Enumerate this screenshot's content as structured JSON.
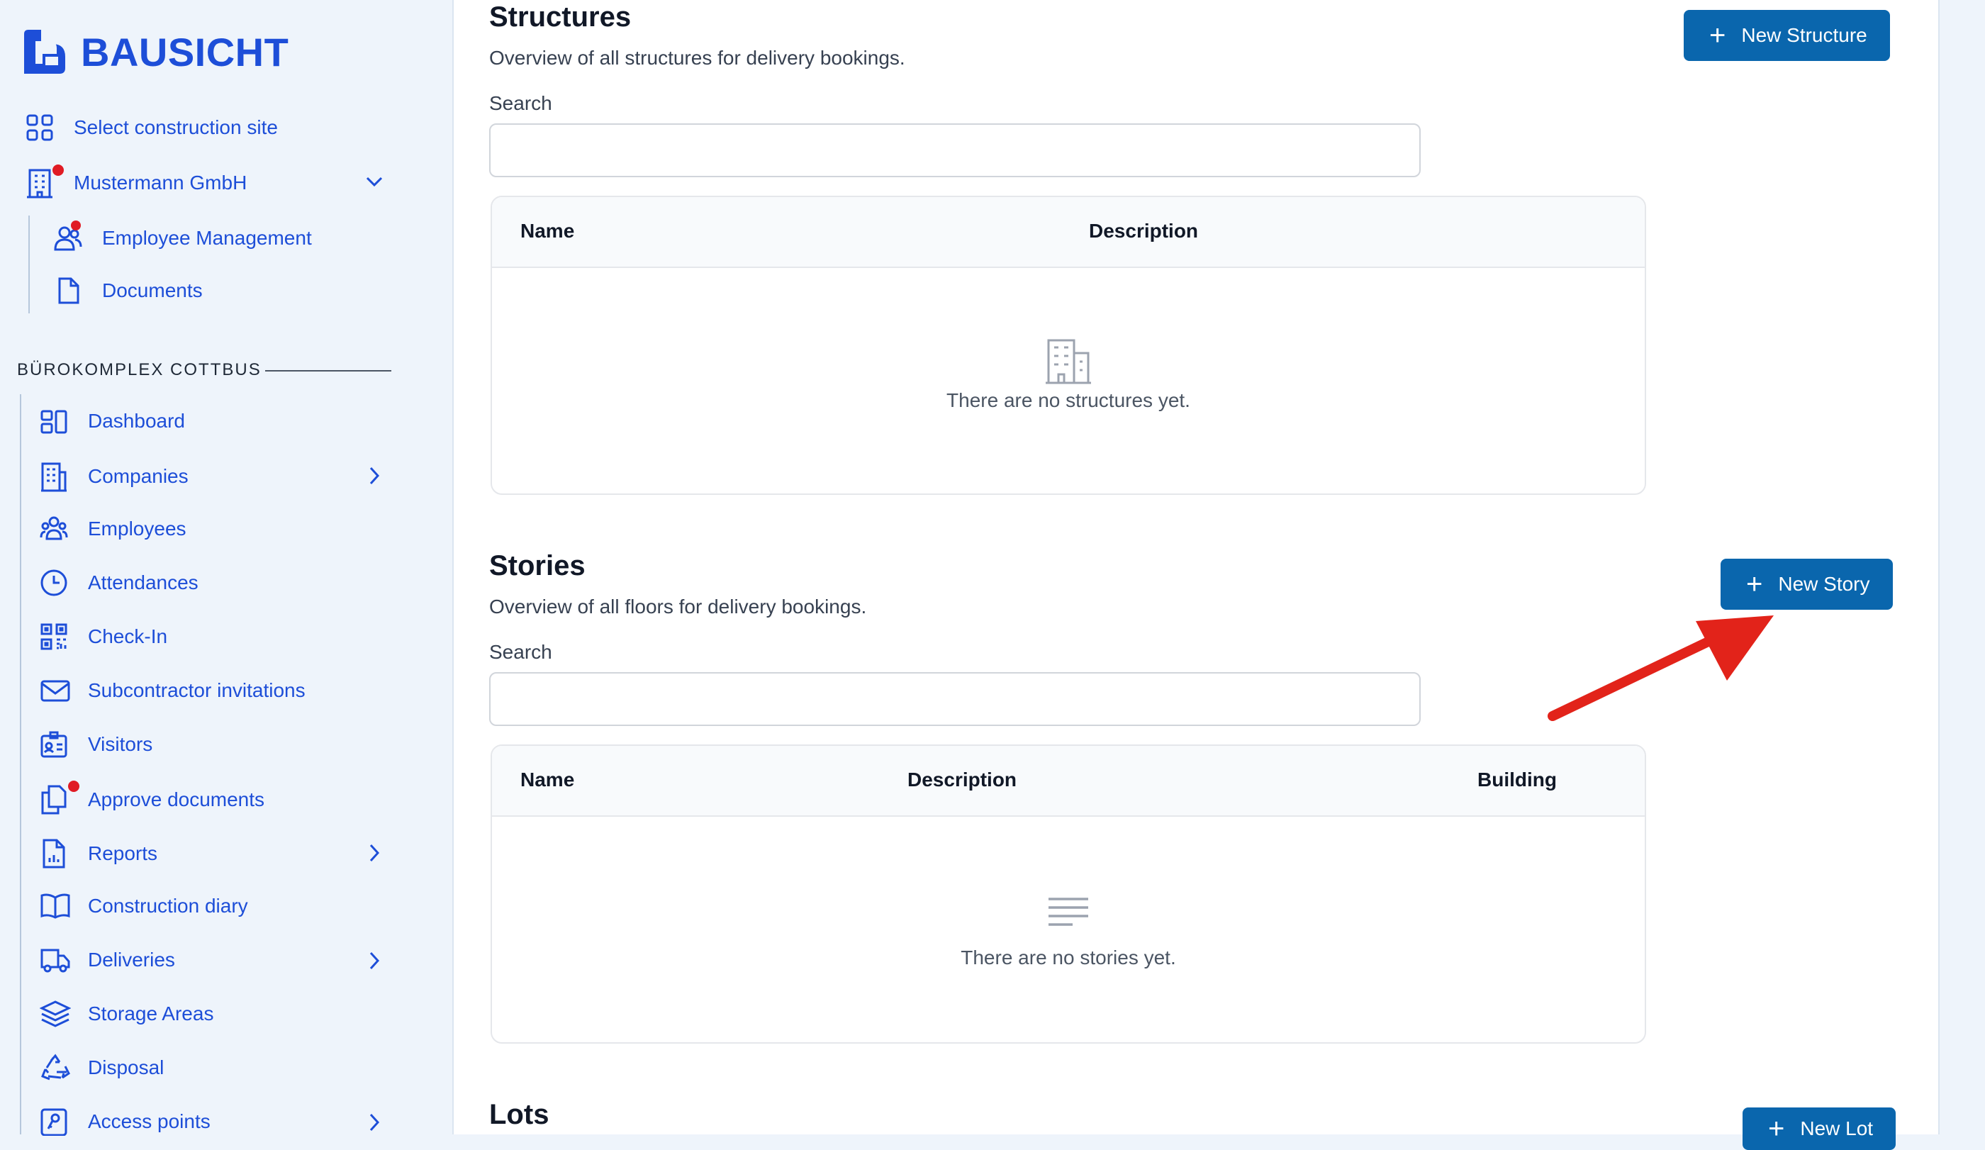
{
  "app": {
    "name": "BAUSICHT"
  },
  "sidebar": {
    "top": [
      {
        "label": "Select construction site",
        "icon": "grid-icon"
      },
      {
        "label": "Mustermann GmbH",
        "icon": "building-icon",
        "has_dot": true,
        "expanded": true
      }
    ],
    "sub": [
      {
        "label": "Employee Management",
        "icon": "users-icon",
        "has_dot": true
      },
      {
        "label": "Documents",
        "icon": "document-icon"
      }
    ],
    "section_title": "BÜROKOMPLEX COTTBUS",
    "items": [
      {
        "label": "Dashboard",
        "icon": "dashboard-icon"
      },
      {
        "label": "Companies",
        "icon": "building-icon",
        "has_children": true
      },
      {
        "label": "Employees",
        "icon": "users-group-icon"
      },
      {
        "label": "Attendances",
        "icon": "clock-icon"
      },
      {
        "label": "Check-In",
        "icon": "qr-code-icon"
      },
      {
        "label": "Subcontractor invitations",
        "icon": "envelope-icon"
      },
      {
        "label": "Visitors",
        "icon": "id-badge-icon"
      },
      {
        "label": "Approve documents",
        "icon": "documents-icon",
        "has_dot": true
      },
      {
        "label": "Reports",
        "icon": "report-icon",
        "has_children": true
      },
      {
        "label": "Construction diary",
        "icon": "book-icon"
      },
      {
        "label": "Deliveries",
        "icon": "truck-icon",
        "has_children": true
      },
      {
        "label": "Storage Areas",
        "icon": "layers-icon"
      },
      {
        "label": "Disposal",
        "icon": "recycle-icon"
      },
      {
        "label": "Access points",
        "icon": "key-card-icon",
        "has_children": true
      }
    ]
  },
  "structures": {
    "title": "Structures",
    "subtitle": "Overview of all structures for delivery bookings.",
    "search_label": "Search",
    "search_value": "",
    "button": "New Structure",
    "columns": [
      "Name",
      "Description"
    ],
    "empty_text": "There are no structures yet."
  },
  "stories": {
    "title": "Stories",
    "subtitle": "Overview of all floors for delivery bookings.",
    "search_label": "Search",
    "search_value": "",
    "button": "New Story",
    "columns": [
      "Name",
      "Description",
      "Building"
    ],
    "empty_text": "There are no stories yet."
  },
  "lots": {
    "title": "Lots",
    "button": "New Lot"
  },
  "colors": {
    "accent": "#1d4ed8",
    "button": "#0a66ad",
    "dot": "#e01b24",
    "arrow": "#e2231a"
  }
}
